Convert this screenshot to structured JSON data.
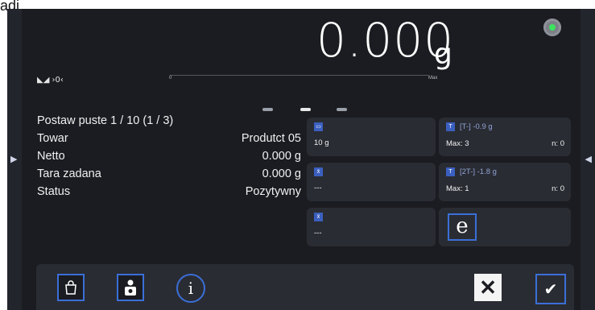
{
  "top_fragment": "adi.",
  "display": {
    "weight": "0.000",
    "unit": "g",
    "indicators": "◣◢ ›0‹",
    "range_min": "0",
    "range_max": "Max"
  },
  "info": [
    {
      "label": "Postaw puste 1 / 10 (1 / 3)",
      "value": ""
    },
    {
      "label": "Towar",
      "value": "Produtct 05"
    },
    {
      "label": "Netto",
      "value": "0.000 g"
    },
    {
      "label": "Tara zadana",
      "value": "0.000 g"
    },
    {
      "label": "Status",
      "value": "Pozytywny"
    }
  ],
  "tiles": {
    "t1": {
      "icon": "weight-unit-icon",
      "value": "10 g"
    },
    "t2": {
      "icon": "xbar-icon",
      "value": "---"
    },
    "t3": {
      "icon": "xbar-min-icon",
      "value": "---"
    },
    "t4": {
      "icon": "tare-icon",
      "title": "[T-]  -0.9 g",
      "max": "Max: 3",
      "n": "n: 0"
    },
    "t5": {
      "icon": "tare2-icon",
      "title": "[2T-]  -1.8 g",
      "max": "Max: 1",
      "n": "n: 0"
    }
  },
  "e_button": "e",
  "colors": {
    "accent": "#3a6fd8",
    "background": "#1b1c21",
    "led": "#3de25e"
  }
}
